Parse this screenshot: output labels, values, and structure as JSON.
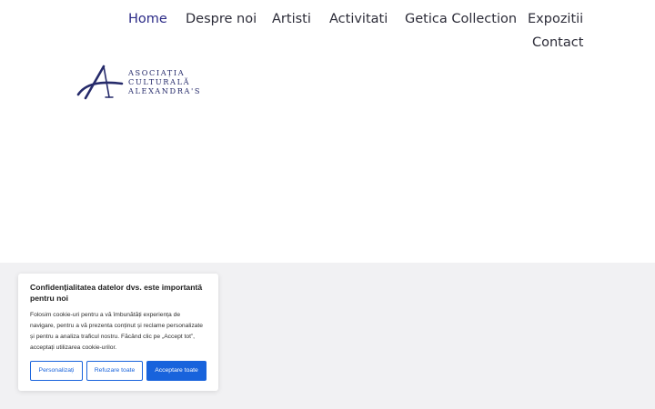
{
  "nav": {
    "items": [
      {
        "label": "Home",
        "active": true
      },
      {
        "label": "Despre noi",
        "active": false
      },
      {
        "label": "Artisti",
        "active": false
      },
      {
        "label": "Activitati",
        "active": false
      },
      {
        "label": "Getica Collection",
        "active": false
      },
      {
        "label": "Expozitii",
        "active": false
      },
      {
        "label": "Contact",
        "active": false
      }
    ]
  },
  "logo": {
    "lines": [
      "ASOCIAȚIA",
      "CULTURALĂ",
      "ALEXANDRA'S"
    ],
    "color": "#252a6a"
  },
  "cookie_banner": {
    "title": "Confidențialitatea datelor dvs. este importantă pentru noi",
    "body": "Folosim cookie-uri pentru a vă îmbunătăți experiența de navigare, pentru a vă prezenta conținut și reclame personalizate și pentru a analiza traficul nostru. Făcând clic pe „Accept tot”, acceptați utilizarea cookie-urilor.",
    "buttons": {
      "customize": "Personalizați",
      "reject": "Refuzare toate",
      "accept": "Acceptare toate"
    },
    "accent_color": "#1863dc"
  },
  "colors": {
    "nav_active": "#2b2a86",
    "nav_text": "#2c2c38",
    "band_background": "#f1f1f3"
  }
}
